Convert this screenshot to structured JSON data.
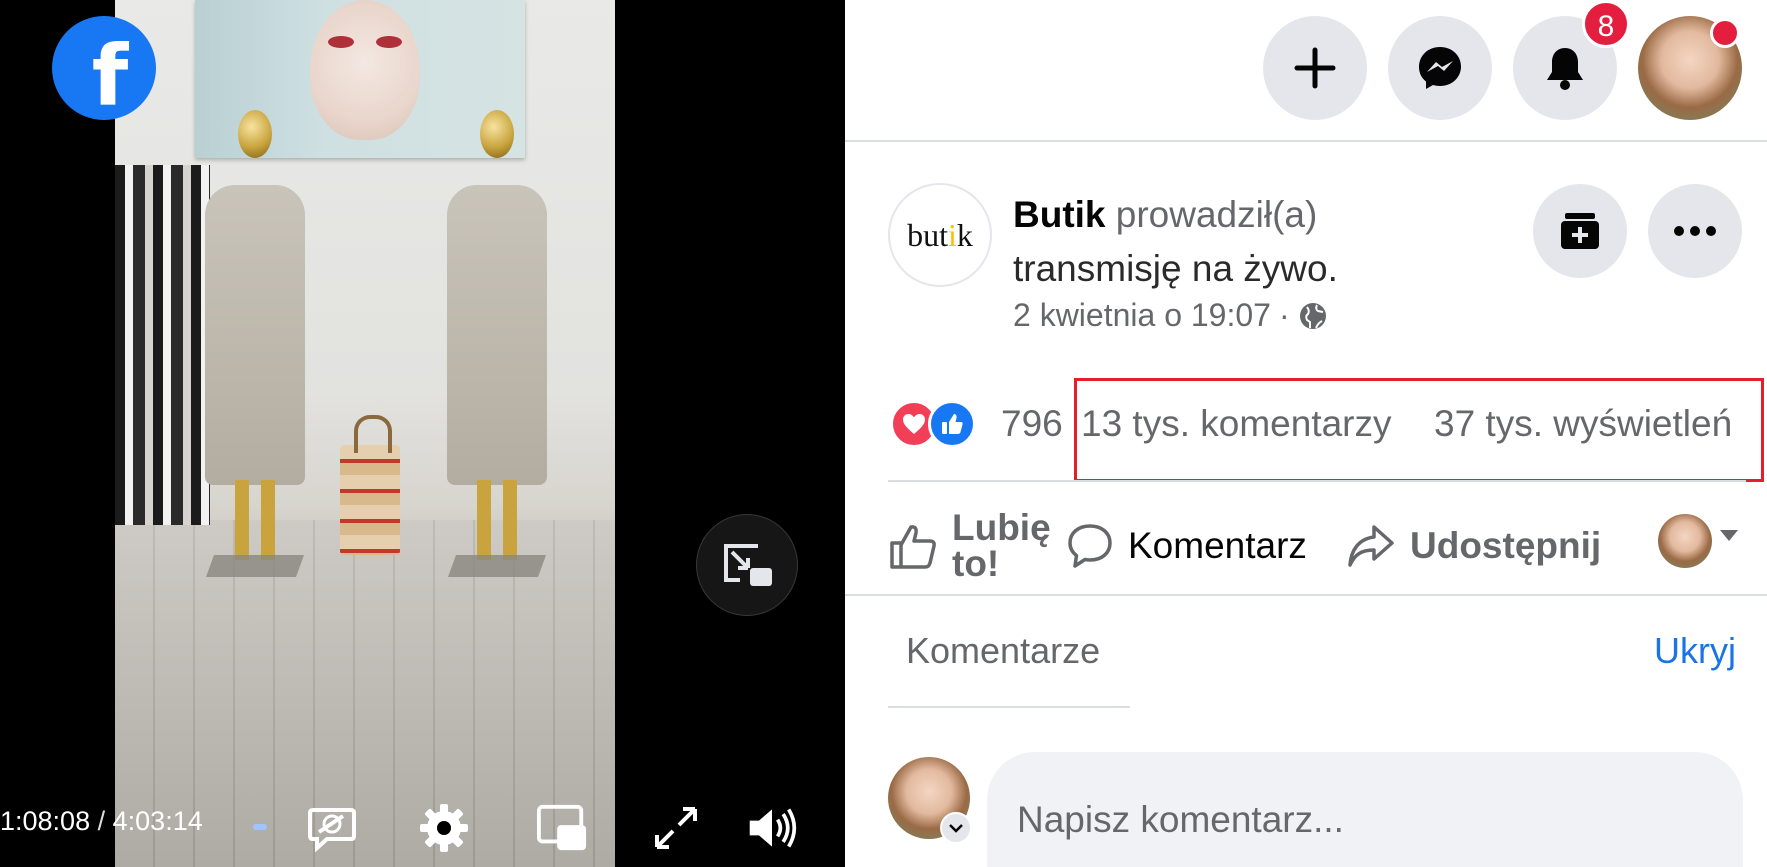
{
  "video": {
    "logo_letter": "f",
    "time_current": "1:08:08",
    "time_separator": "/",
    "time_total": "4:03:14",
    "controls": [
      "captions-off-icon",
      "settings-icon",
      "miniplayer-icon",
      "fullscreen-icon",
      "volume-icon"
    ]
  },
  "header": {
    "buttons": [
      "create-plus-icon",
      "messenger-icon",
      "bell-icon"
    ],
    "notification_count": "8",
    "accent": "#1877f2",
    "badge_color": "#e41e3f"
  },
  "post": {
    "page_logo_pre": "but",
    "page_logo_dot": "i",
    "page_logo_post": "k",
    "page_name": "Butik",
    "action_line1": "prowadził(a)",
    "action_line2": "transmisję na żywo.",
    "timestamp": "2 kwietnia o 19:07",
    "meta_sep": "·",
    "privacy_icon": "globe-icon"
  },
  "stats": {
    "reactions": [
      "love-reaction-icon",
      "like-reaction-icon"
    ],
    "reaction_count": "796",
    "comments": "13 tys. komentarzy",
    "views": "37 tys. wyświetleń",
    "highlight_color": "#e41e2d"
  },
  "actions": {
    "like_line1": "Lubię",
    "like_line2": "to!",
    "comment": "Komentarz",
    "share": "Udostępnij"
  },
  "comments": {
    "title": "Komentarze",
    "hide": "Ukryj",
    "input_placeholder": "Napisz komentarz..."
  }
}
